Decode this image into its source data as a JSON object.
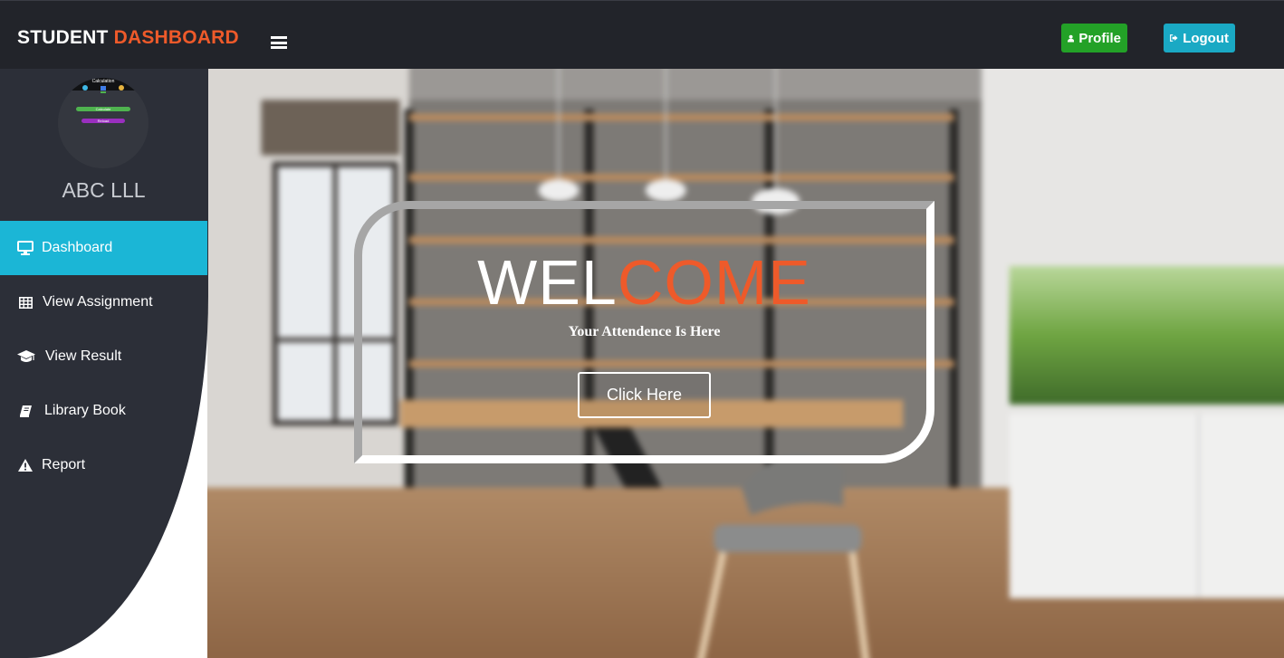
{
  "header": {
    "brand_part1": "STUDENT ",
    "brand_part2": "DASHBOARD",
    "profile_label": "Profile",
    "logout_label": "Logout"
  },
  "sidebar": {
    "avatar_texts": {
      "title": "Calculation",
      "calculate": "Calculate",
      "reload": "Reload"
    },
    "user_name": "ABC LLL",
    "items": [
      {
        "label": "Dashboard",
        "icon": "desktop-icon",
        "active": true
      },
      {
        "label": "View Assignment",
        "icon": "table-icon",
        "active": false
      },
      {
        "label": "View Result",
        "icon": "graduation-cap-icon",
        "active": false
      },
      {
        "label": "Library Book",
        "icon": "book-icon",
        "active": false
      },
      {
        "label": "Report",
        "icon": "warning-icon",
        "active": false
      }
    ]
  },
  "hero": {
    "welcome_part1": "WEL",
    "welcome_part2": "COME",
    "subtitle": "Your Attendence Is Here",
    "button_label": "Click Here"
  },
  "colors": {
    "topbar": "#22242a",
    "sidebar": "#2c2f38",
    "accent_orange": "#ee5a2a",
    "active_menu": "#1bb6d6",
    "profile_button": "#23a127",
    "logout_button": "#1aa9c4"
  }
}
